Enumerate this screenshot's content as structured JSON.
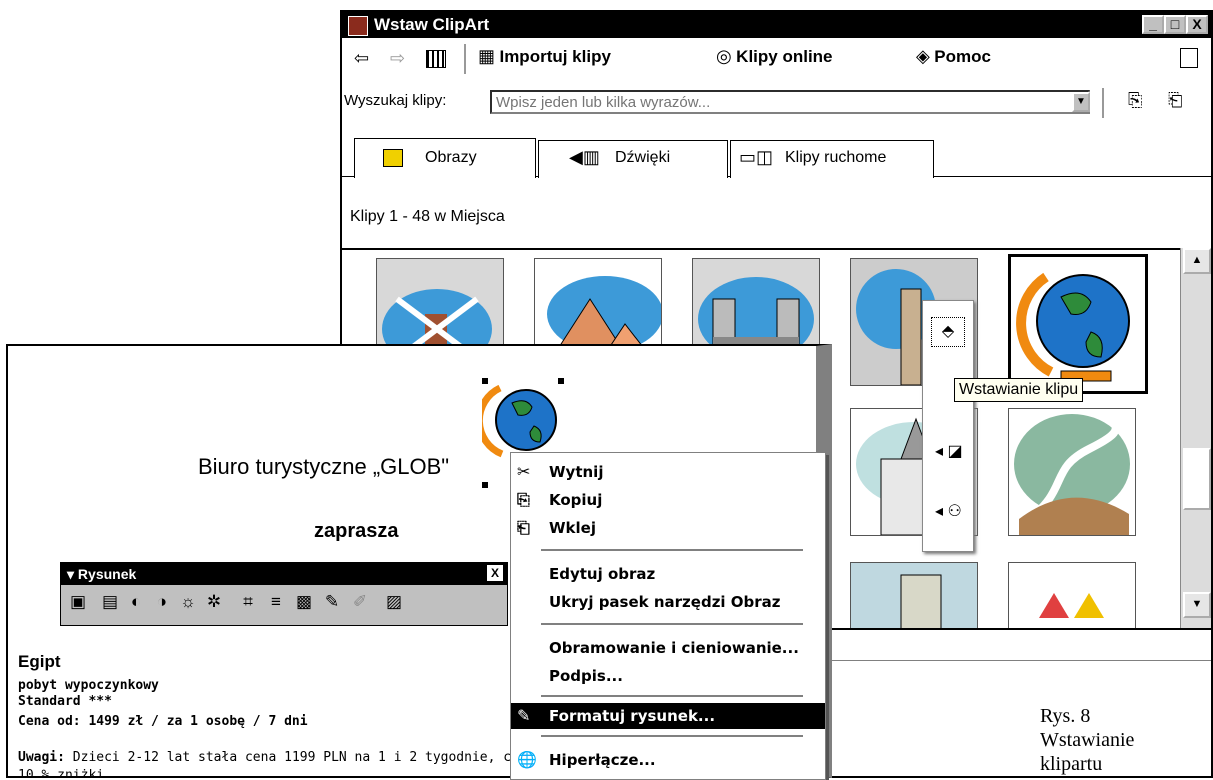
{
  "clipart_window": {
    "title": "Wstaw ClipArt",
    "buttons": {
      "minimize": "_",
      "maximize": "□",
      "close": "X"
    },
    "toolbar": {
      "back_icon": "arrow-left-icon",
      "forward_icon": "arrow-right-icon",
      "grid_icon": "grid-icon",
      "import_label": "Importuj klipy",
      "online_label": "Klipy online",
      "help_label": "Pomoc",
      "side_icon": "pane-icon"
    },
    "search": {
      "label": "Wyszukaj klipy:",
      "placeholder": "Wpisz jeden lub kilka wyrazów..."
    },
    "tabs": [
      {
        "label": "Obrazy",
        "icon": "image-icon"
      },
      {
        "label": "Dźwięki",
        "icon": "sound-icon"
      },
      {
        "label": "Klipy ruchome",
        "icon": "movie-icon"
      }
    ],
    "clips_info": "Klipy 1 - 48 w Miejsca",
    "thumbnails": [
      "windmill",
      "pyramids",
      "tower-bridge",
      "statue",
      "globe",
      "church",
      "winding-road",
      "building",
      "carousel"
    ],
    "tooltip": "Wstawianie klipu"
  },
  "document": {
    "title": "Biuro turystyczne „GLOB\"",
    "subtitle": "zaprasza",
    "toolbar": {
      "title": "▾ Rysunek",
      "close": "X"
    },
    "section": "Egipt",
    "lines": [
      "pobyt wypoczynkowy",
      "Standard ***",
      "Cena od: 1499 zł / za 1 osobę / 7 dni"
    ],
    "note_label": "Uwagi:",
    "note_text": "Dzieci 2-12 lat stała cena 1199 PLN na 1 i 2 tygodnie, c",
    "note_line2": "10 % zniżki"
  },
  "context_menu": {
    "items": [
      {
        "label": "Wytnij",
        "icon": "scissors-icon"
      },
      {
        "label": "Kopiuj",
        "icon": "copy-icon"
      },
      {
        "label": "Wklej",
        "icon": "paste-icon"
      },
      {
        "label": "Edytuj obraz",
        "icon": ""
      },
      {
        "label": "Ukryj pasek narzędzi Obraz",
        "icon": ""
      },
      {
        "label": "Obramowanie i cieniowanie...",
        "icon": ""
      },
      {
        "label": "Podpis...",
        "icon": ""
      },
      {
        "label": "Formatuj rysunek...",
        "icon": "format-picture-icon"
      },
      {
        "label": "Hiperłącze...",
        "icon": "hyperlink-icon"
      }
    ],
    "highlighted_index": 7
  },
  "caption": {
    "line1": "Rys. 8",
    "line2": "Wstawianie",
    "line3": "klipartu"
  },
  "colors": {
    "titlebar": "#000000",
    "highlight": "#000000",
    "globe_ocean": "#1e73c8",
    "globe_land": "#2e8b3a",
    "globe_frame": "#f08a10"
  }
}
